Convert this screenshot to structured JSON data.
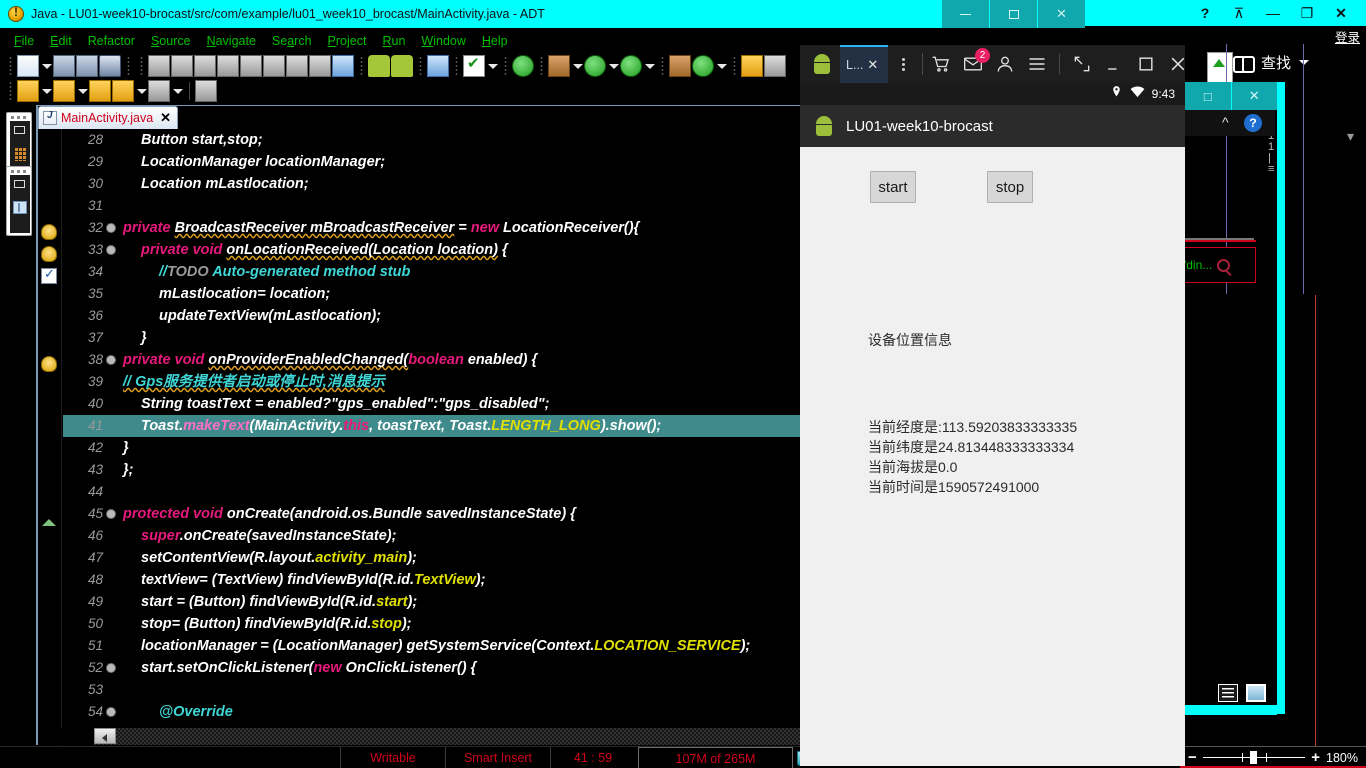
{
  "eclipse": {
    "window_title": "Java - LU01-week10-brocast/src/com/example/lu01_week10_brocast/MainActivity.java - ADT",
    "title_icon": "warning-circle-icon",
    "window_buttons": [
      {
        "name": "minimize",
        "glyph": "—"
      },
      {
        "name": "maximize",
        "glyph": "□"
      },
      {
        "name": "close",
        "glyph": "✕"
      }
    ],
    "menu": [
      "File",
      "Edit",
      "Refactor",
      "Source",
      "Navigate",
      "Search",
      "Project",
      "Run",
      "Window",
      "Help"
    ],
    "tab": {
      "label": "MainActivity.java",
      "close": "✕"
    },
    "status": {
      "writable": "Writable",
      "insert_mode": "Smart Insert",
      "caret": "41 : 59",
      "memory": "107M of 265M"
    },
    "code": [
      {
        "n": "28",
        "fold": false,
        "marker": "",
        "indent": 1,
        "html": "<span class=\"kw\"></span>Button start,stop;"
      },
      {
        "n": "29",
        "fold": false,
        "marker": "",
        "indent": 1,
        "html": "LocationManager locationManager;"
      },
      {
        "n": "30",
        "fold": false,
        "marker": "",
        "indent": 1,
        "html": "Location mLastlocation;"
      },
      {
        "n": "31",
        "fold": false,
        "marker": "",
        "indent": 1,
        "html": ""
      },
      {
        "n": "32",
        "fold": true,
        "marker": "warn",
        "indent": 0,
        "html": "<span class=\"kw\">private</span> <span class=\"squig\">BroadcastReceiver mBroadcastReceiver</span> = <span class=\"kw\">new</span> LocationReceiver(){"
      },
      {
        "n": "33",
        "fold": true,
        "marker": "warn",
        "indent": 1,
        "html": "<span class=\"kw\">private void</span> <span class=\"squig\">onLocationReceived(Location location)</span> {"
      },
      {
        "n": "34",
        "fold": false,
        "marker": "task",
        "indent": 2,
        "html": "<span class=\"cmt\">//</span><span class=\"cmt-todo\">TODO</span> <span class=\"cmt\">Auto-generated method stub</span>"
      },
      {
        "n": "35",
        "fold": false,
        "marker": "",
        "indent": 2,
        "html": "mLastlocation= location;"
      },
      {
        "n": "36",
        "fold": false,
        "marker": "",
        "indent": 2,
        "html": "updateTextView(mLastlocation);"
      },
      {
        "n": "37",
        "fold": false,
        "marker": "",
        "indent": 1,
        "html": "}"
      },
      {
        "n": "38",
        "fold": true,
        "marker": "warn",
        "indent": 0,
        "html": "<span class=\"kw\">private void</span> <span class=\"squig\">onProviderEnabledChanged(</span><span class=\"kw\">boolean</span> enabled) {"
      },
      {
        "n": "39",
        "fold": false,
        "marker": "",
        "indent": 0,
        "html": "<span class=\"cmt squig\">// Gps服务提供者启动或停止时,消息提示</span>"
      },
      {
        "n": "40",
        "fold": false,
        "marker": "",
        "indent": 1,
        "html": "String toastText = enabled?\"gps_enabled\":\"gps_disabled\";"
      },
      {
        "n": "41",
        "fold": false,
        "marker": "",
        "indent": 1,
        "html": "Toast.<span class=\"mth\">makeText</span>(MainActivity.<span class=\"kw\">this</span>, toastText, Toast.<span class=\"fld\">LENGTH_LONG</span>).show();",
        "selected": true
      },
      {
        "n": "42",
        "fold": false,
        "marker": "",
        "indent": 0,
        "html": "}"
      },
      {
        "n": "43",
        "fold": false,
        "marker": "",
        "indent": 0,
        "html": "};"
      },
      {
        "n": "44",
        "fold": false,
        "marker": "",
        "indent": 0,
        "html": ""
      },
      {
        "n": "45",
        "fold": true,
        "marker": "up",
        "indent": 0,
        "html": "<span class=\"kw\">protected void</span> onCreate(android.os.Bundle savedInstanceState) {"
      },
      {
        "n": "46",
        "fold": false,
        "marker": "",
        "indent": 1,
        "html": "<span class=\"kw\">super</span>.onCreate(savedInstanceState);"
      },
      {
        "n": "47",
        "fold": false,
        "marker": "",
        "indent": 1,
        "html": "setContentView(R.layout.<span class=\"fld\">activity_main</span>);"
      },
      {
        "n": "48",
        "fold": false,
        "marker": "",
        "indent": 1,
        "html": "textView= (TextView) findViewById(R.id.<span class=\"fld\">TextView</span>);"
      },
      {
        "n": "49",
        "fold": false,
        "marker": "",
        "indent": 1,
        "html": "start = (Button) findViewById(R.id.<span class=\"fld\">start</span>);"
      },
      {
        "n": "50",
        "fold": false,
        "marker": "",
        "indent": 1,
        "html": "stop= (Button) findViewById(R.id.<span class=\"fld\">stop</span>);"
      },
      {
        "n": "51",
        "fold": false,
        "marker": "",
        "indent": 1,
        "html": "locationManager = (LocationManager) getSystemService(Context.<span class=\"fld\">LOCATION_SERVICE</span>);"
      },
      {
        "n": "52",
        "fold": true,
        "marker": "",
        "indent": 1,
        "html": "start.setOnClickListener(<span class=\"kw\">new</span> OnClickListener() {"
      },
      {
        "n": "53",
        "fold": false,
        "marker": "",
        "indent": 1,
        "html": ""
      },
      {
        "n": "54",
        "fold": true,
        "marker": "",
        "indent": 2,
        "html": "<span class=\"cmt\">@Override</span>"
      }
    ]
  },
  "right_window": {
    "buttons": [
      {
        "name": "help",
        "glyph": "?"
      },
      {
        "name": "restore-pane",
        "glyph": "⊼"
      },
      {
        "name": "minimize",
        "glyph": "—"
      },
      {
        "name": "restore",
        "glyph": "❐"
      },
      {
        "name": "close",
        "glyph": "✕"
      }
    ],
    "login_label": "登录",
    "find_label": "查找",
    "find_popup_text": "\"din...",
    "find_popup_icon": "magnifier-icon"
  },
  "emulator": {
    "tab_label": "L...",
    "tab_close": "✕",
    "toolbar_icons": [
      {
        "name": "cart-icon",
        "glyph": "🛒"
      },
      {
        "name": "mail-icon",
        "glyph": "✉",
        "badge": "2"
      },
      {
        "name": "account-icon",
        "glyph": "👤"
      },
      {
        "name": "menu-icon",
        "glyph": "☰"
      },
      {
        "name": "resize-icon",
        "glyph": "⤢"
      },
      {
        "name": "minimize-icon",
        "glyph": "_"
      },
      {
        "name": "maximize-icon",
        "glyph": "□"
      },
      {
        "name": "close-icon",
        "glyph": "✕"
      }
    ],
    "statusbar": {
      "location_icon": "location-pin-icon",
      "wifi_icon": "wifi-icon",
      "time": "9:43"
    },
    "app_title": "LU01-week10-brocast",
    "buttons": [
      {
        "name": "start-button",
        "label": "start"
      },
      {
        "name": "stop-button",
        "label": "stop"
      }
    ],
    "section_label": "设备位置信息",
    "info_lines": [
      "当前经度是:113.59203833333335",
      "当前纬度是24.813448333333334",
      "当前海拔是0.0",
      "当前时间是1590572491000"
    ],
    "tray_icons": [
      {
        "name": "list-view-icon"
      },
      {
        "name": "image-preview-icon"
      }
    ]
  },
  "zoom_control": {
    "minus": "−",
    "plus": "+",
    "percent": "180%"
  },
  "colors": {
    "titlebar_cyan": "#00ffff",
    "menu_green": "#00c000",
    "tab_label_red": "#d0021b",
    "keyword_pink": "#e8197d",
    "comment_cyan": "#3fd6d6",
    "field_yellow": "#e0e000",
    "selection_teal": "#3f8a8a",
    "accent_blue": "#29b6f6",
    "badge_pink": "#e91e63"
  }
}
